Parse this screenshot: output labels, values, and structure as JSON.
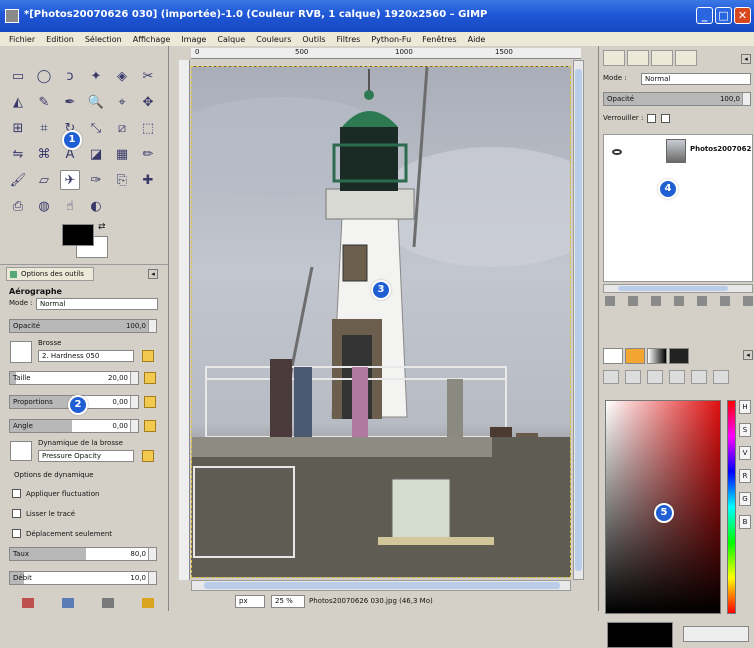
{
  "window": {
    "title": "*[Photos20070626 030] (importée)-1.0 (Couleur RVB, 1 calque) 1920x2560 – GIMP",
    "buttons": {
      "minimize": "_",
      "maximize": "□",
      "close": "✕"
    }
  },
  "menubar": {
    "items": [
      "Fichier",
      "Edition",
      "Sélection",
      "Affichage",
      "Image",
      "Calque",
      "Couleurs",
      "Outils",
      "Filtres",
      "Python-Fu",
      "Fenêtres",
      "Aide"
    ]
  },
  "toolbox": {
    "icons": [
      "rect-select-icon",
      "ellipse-select-icon",
      "lasso-icon",
      "fuzzy-select-icon",
      "color-select-icon",
      "scissors-icon",
      "foreground-select-icon",
      "paths-icon",
      "color-picker-icon",
      "zoom-icon",
      "measure-icon",
      "move-icon",
      "align-icon",
      "crop-icon",
      "rotate-icon",
      "scale-icon",
      "shear-icon",
      "perspective-icon",
      "flip-icon",
      "cage-icon",
      "text-icon",
      "bucket-fill-icon",
      "blend-icon",
      "pencil-icon",
      "paintbrush-icon",
      "eraser-icon",
      "airbrush-icon",
      "ink-icon",
      "clone-icon",
      "heal-icon",
      "perspective-clone-icon",
      "blur-icon",
      "smudge-icon",
      "dodge-burn-icon"
    ],
    "active_index": 26,
    "foreground_color": "#000000",
    "background_color": "#ffffff"
  },
  "tool_options": {
    "tab_label": "Options des outils",
    "title": "Aérographe",
    "mode_label": "Mode :",
    "mode_value": "Normal",
    "opacity_label": "Opacité",
    "opacity_value": "100,0",
    "brush_label": "Brosse",
    "brush_value": "2. Hardness 050",
    "size_label": "Taille",
    "size_value": "20,00",
    "aspect_label": "Proportions",
    "aspect_value": "0,00",
    "angle_label": "Angle",
    "angle_value": "0,00",
    "dynamics_label": "Dynamique de la brosse",
    "dynamics_value": "Pressure Opacity",
    "dynamics_options": "Options de dynamique",
    "checkboxes": [
      "Appliquer fluctuation",
      "Lisser le tracé",
      "Déplacement seulement"
    ],
    "rate_label": "Taux",
    "rate_value": "80,0",
    "flow_label": "Débit",
    "flow_value": "10,0"
  },
  "canvas": {
    "ruler_labels": [
      "0",
      "500",
      "1000",
      "1500"
    ],
    "unit": "px",
    "zoom": "25 %",
    "status": "Photos20070626 030.jpg (46,3 Mo)"
  },
  "layers": {
    "mode_label": "Mode :",
    "mode_value": "Normal",
    "opacity_label": "Opacité",
    "opacity_value": "100,0",
    "lock_label": "Verrouiller :",
    "layer_name": "Photos2007062"
  },
  "colors": {
    "channels": [
      "H",
      "S",
      "V",
      "R",
      "G",
      "B"
    ],
    "foreground": "#000000"
  },
  "badges": [
    "1",
    "2",
    "3",
    "4",
    "5"
  ]
}
